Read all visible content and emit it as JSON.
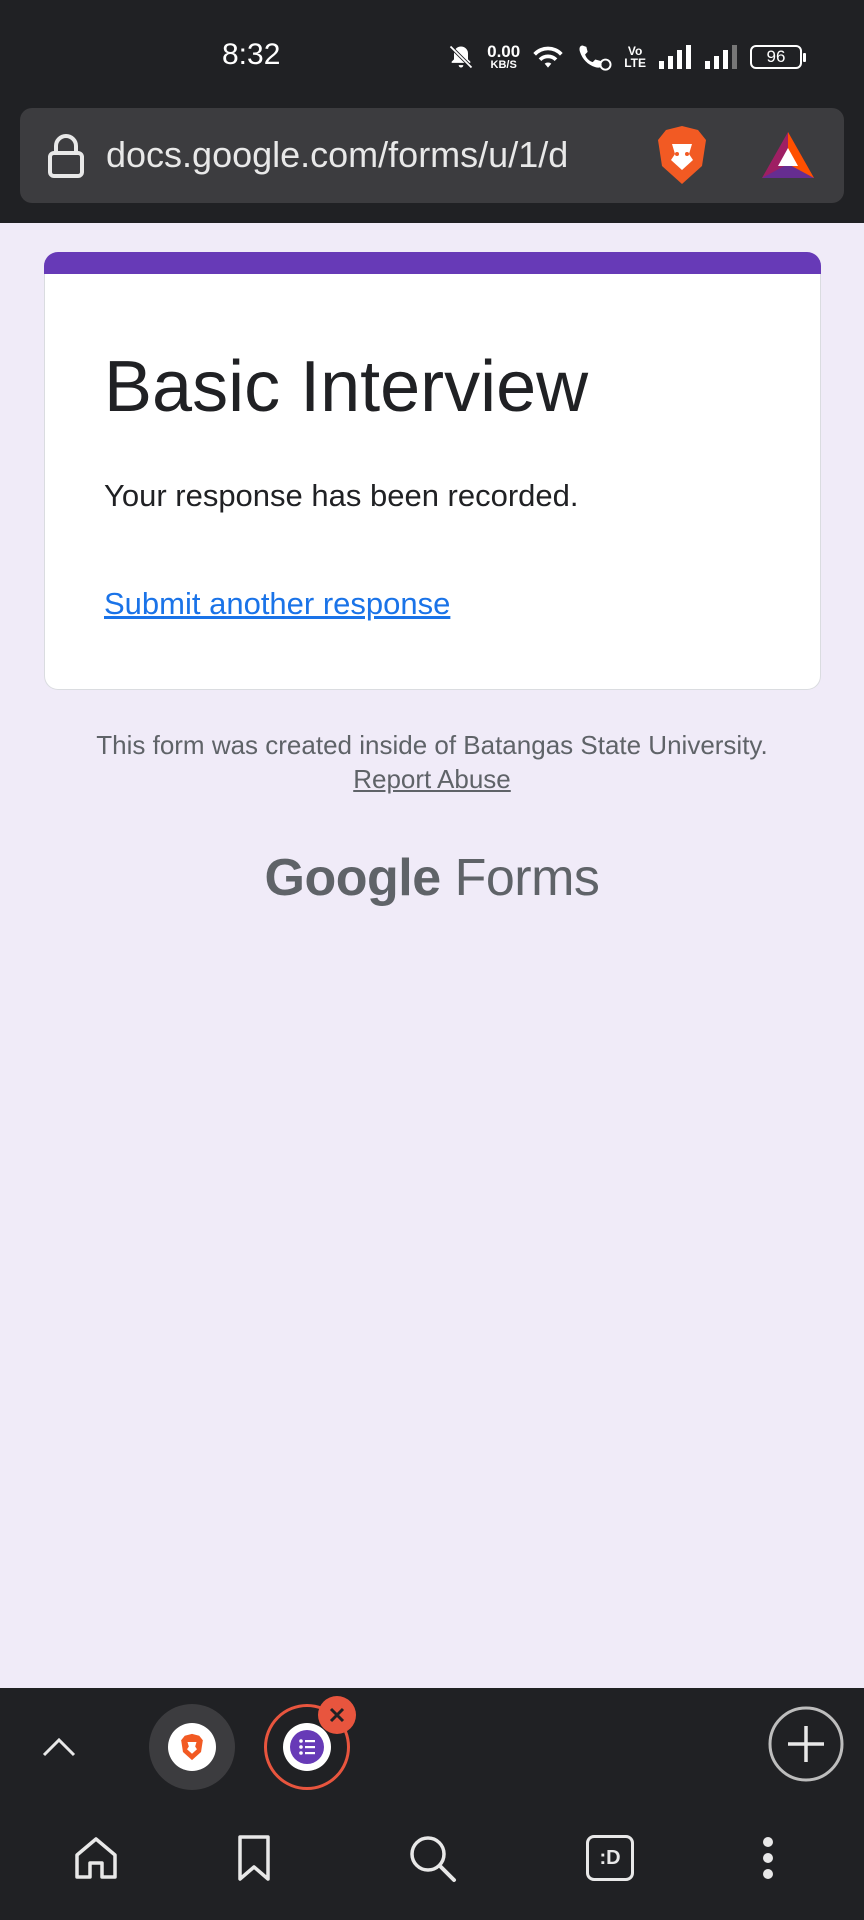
{
  "status_bar": {
    "time": "8:32",
    "net_speed_value": "0.00",
    "net_speed_unit": "KB/S",
    "volte_top": "Vo",
    "volte_bottom": "LTE",
    "battery": "96"
  },
  "browser": {
    "url": "docs.google.com/forms/u/1/d"
  },
  "form": {
    "title": "Basic Interview",
    "message": "Your response has been recorded.",
    "link": "Submit another response"
  },
  "footer": {
    "note_prefix": "This form was created inside of Batangas State University.",
    "report_abuse": "Report Abuse",
    "brand_google": "Google",
    "brand_forms": "Forms"
  },
  "tab_bar": {
    "active_tab_label": ":D"
  },
  "colors": {
    "accent": "#673ab7",
    "link": "#1a73e8",
    "page_bg": "#f0ebf8",
    "close_badge": "#e8553e"
  }
}
